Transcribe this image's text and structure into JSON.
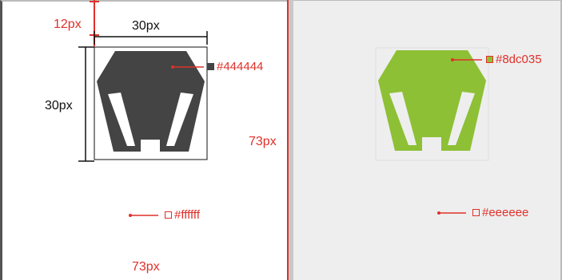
{
  "left_panel": {
    "spacing_top_label": "12px",
    "width_label": "30px",
    "height_label": "30px",
    "spacing_right_label": "73px",
    "spacing_bottom_label": "73px",
    "icon_color_label": "#444444",
    "icon_color": "#444444",
    "background_color_label": "#ffffff",
    "background_color": "#ffffff"
  },
  "right_panel": {
    "icon_color_label": "#8dc035",
    "icon_color": "#8dc035",
    "background_color_label": "#eeeeee",
    "background_color": "#eeeeee"
  },
  "colors": {
    "annotation": "#e0302a",
    "dimension": "#111111"
  },
  "icons": [
    "lamp-icon",
    "lamp-icon"
  ]
}
